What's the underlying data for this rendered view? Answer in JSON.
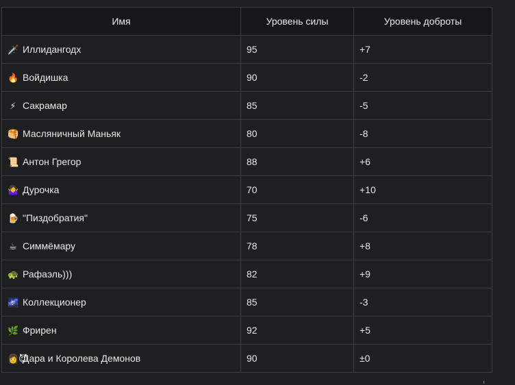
{
  "table": {
    "headers": {
      "name": "Имя",
      "power": "Уровень силы",
      "kindness": "Уровень доброты"
    },
    "rows": [
      {
        "icon": "🗡️",
        "icon_name": "dagger-icon",
        "name": "Иллидангодх",
        "power": "95",
        "kindness": "+7"
      },
      {
        "icon": "🔥",
        "icon_name": "fire-icon",
        "name": "Войдишка",
        "power": "90",
        "kindness": "-2"
      },
      {
        "icon": "⚡",
        "icon_name": "lightning-icon",
        "name": "Сакрамар",
        "power": "85",
        "kindness": "-5"
      },
      {
        "icon": "🥞",
        "icon_name": "pancakes-icon",
        "name": "Масляничный Маньяк",
        "power": "80",
        "kindness": "-8"
      },
      {
        "icon": "📜",
        "icon_name": "scroll-icon",
        "name": "Антон Грегор",
        "power": "88",
        "kindness": "+6"
      },
      {
        "icon": "🤷‍♀️",
        "icon_name": "shrug-icon",
        "name": "Дурочка",
        "power": "70",
        "kindness": "+10"
      },
      {
        "icon": "🍺",
        "icon_name": "beer-icon",
        "name": "\"Пиздобратия\"",
        "power": "75",
        "kindness": "-6"
      },
      {
        "icon": "☕",
        "icon_name": "coffee-icon",
        "name": "Симмёмару",
        "power": "78",
        "kindness": "+8"
      },
      {
        "icon": "🐢",
        "icon_name": "turtle-icon",
        "name": "Рафаэль)))",
        "power": "82",
        "kindness": "+9"
      },
      {
        "icon": "🌌",
        "icon_name": "galaxy-icon",
        "name": "Коллекционер",
        "power": "85",
        "kindness": "-3"
      },
      {
        "icon": "🌿",
        "icon_name": "herb-icon",
        "name": "Фрирен",
        "power": "92",
        "kindness": "+5"
      },
      {
        "icon": "👩😈",
        "icon_name": "woman-devil-icon",
        "name": "Дара и Королева Демонов",
        "power": "90",
        "kindness": "±0"
      }
    ]
  }
}
